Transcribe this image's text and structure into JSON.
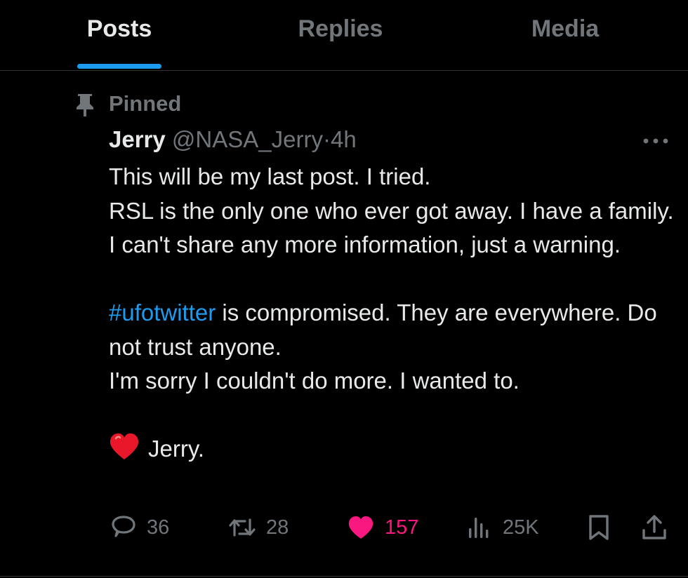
{
  "tabs": [
    {
      "label": "Posts",
      "active": true
    },
    {
      "label": "Replies",
      "active": false
    },
    {
      "label": "Media",
      "active": false
    }
  ],
  "post": {
    "pinned_label": "Pinned",
    "author_name": "Jerry",
    "author_handle": "@NASA_Jerry",
    "separator": "·",
    "time": "4h",
    "lines": {
      "l1": "This will be my last post. I tried.",
      "l2": "RSL is the only one who ever got away. I have a family. I can't share any more information, just a warning.",
      "hashtag": "#ufotwitter",
      "l3_rest": " is compromised. They are everywhere. Do not trust anyone.",
      "l4": "I'm sorry I couldn't do more. I wanted to.",
      "signoff": "Jerry."
    },
    "stats": {
      "replies": "36",
      "reposts": "28",
      "likes": "157",
      "views": "25K"
    }
  },
  "colors": {
    "background": "#000000",
    "text": "#e7e9ea",
    "muted": "#71767b",
    "accent": "#1d9bf0",
    "like": "#f91880",
    "divider": "#2f3336"
  },
  "icons": {
    "pin": "pin-icon",
    "more": "more-icon",
    "reply": "reply-icon",
    "repost": "repost-icon",
    "like": "heart-icon",
    "views": "views-icon",
    "bookmark": "bookmark-icon",
    "share": "share-icon",
    "emoji": "red-heart-emoji"
  }
}
